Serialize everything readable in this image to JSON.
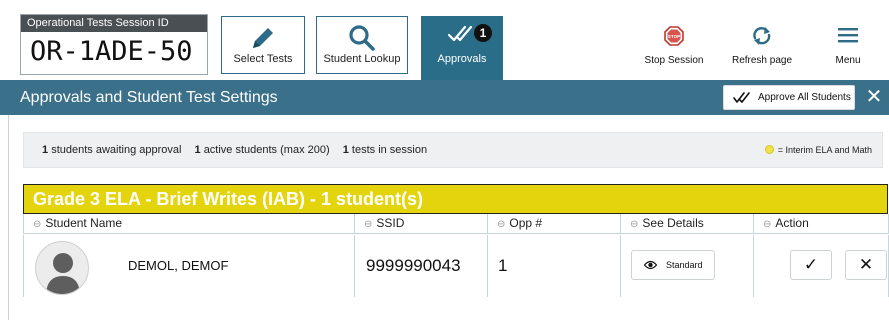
{
  "session": {
    "label": "Operational Tests Session ID",
    "id": "OR-1ADE-50"
  },
  "toolbar": {
    "select_tests": "Select Tests",
    "student_lookup": "Student Lookup",
    "approvals": "Approvals",
    "approvals_count": "1",
    "stop_session": "Stop Session",
    "stop_icon_text": "STOP",
    "refresh_page": "Refresh page",
    "menu": "Menu"
  },
  "header": {
    "title": "Approvals and Student Test Settings",
    "approve_all": "Approve All Students",
    "close": "✕"
  },
  "summary": {
    "awaiting_count": "1",
    "awaiting_text": "students awaiting approval",
    "active_count": "1",
    "active_text": "active students",
    "active_max": "(max 200)",
    "tests_count": "1",
    "tests_text": "tests in session",
    "legend": "= Interim ELA and Math",
    "legend_color": "#f2e24a"
  },
  "group": {
    "title": "Grade 3 ELA - Brief Writes (IAB) - 1 student(s)",
    "color": "#e3d40e"
  },
  "table": {
    "headers": [
      "Student Name",
      "SSID",
      "Opp #",
      "See Details",
      "Action"
    ],
    "rows": [
      {
        "name": "DEMOL, DEMOF",
        "ssid": "9999990043",
        "opp": "1",
        "details": "Standard",
        "approve": "✓",
        "deny": "✕"
      }
    ]
  },
  "colors": {
    "accent": "#2a6d88",
    "header_bar": "#3a7089"
  }
}
